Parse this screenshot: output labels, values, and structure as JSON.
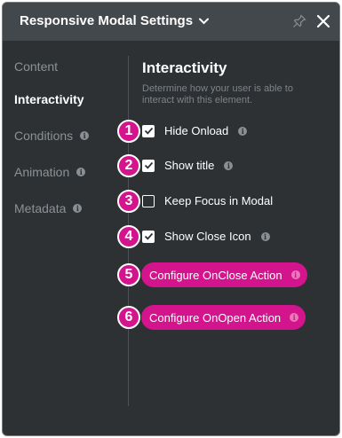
{
  "header": {
    "title": "Responsive Modal Settings",
    "dropdown_icon": "chevron-down-icon",
    "pin_icon": "pin-icon",
    "close_icon": "close-icon"
  },
  "sidebar": {
    "items": [
      {
        "label": "Content",
        "active": false,
        "info": false
      },
      {
        "label": "Interactivity",
        "active": true,
        "info": false
      },
      {
        "label": "Conditions",
        "active": false,
        "info": true
      },
      {
        "label": "Animation",
        "active": false,
        "info": true
      },
      {
        "label": "Metadata",
        "active": false,
        "info": true
      }
    ]
  },
  "main": {
    "title": "Interactivity",
    "description": "Determine how your user is able to interact with this element.",
    "options": [
      {
        "badge": "1",
        "label": "Hide Onload",
        "checked": true,
        "info": true
      },
      {
        "badge": "2",
        "label": "Show title",
        "checked": true,
        "info": true
      },
      {
        "badge": "3",
        "label": "Keep Focus in Modal",
        "checked": false,
        "info": false
      },
      {
        "badge": "4",
        "label": "Show Close Icon",
        "checked": true,
        "info": true
      }
    ],
    "actions": [
      {
        "badge": "5",
        "label": "Configure OnClose Action"
      },
      {
        "badge": "6",
        "label": "Configure OnOpen Action"
      }
    ]
  },
  "info_glyph": "i",
  "colors": {
    "panel_bg": "#2d3134",
    "header_bg": "#43484c",
    "accent": "#d4148c"
  }
}
